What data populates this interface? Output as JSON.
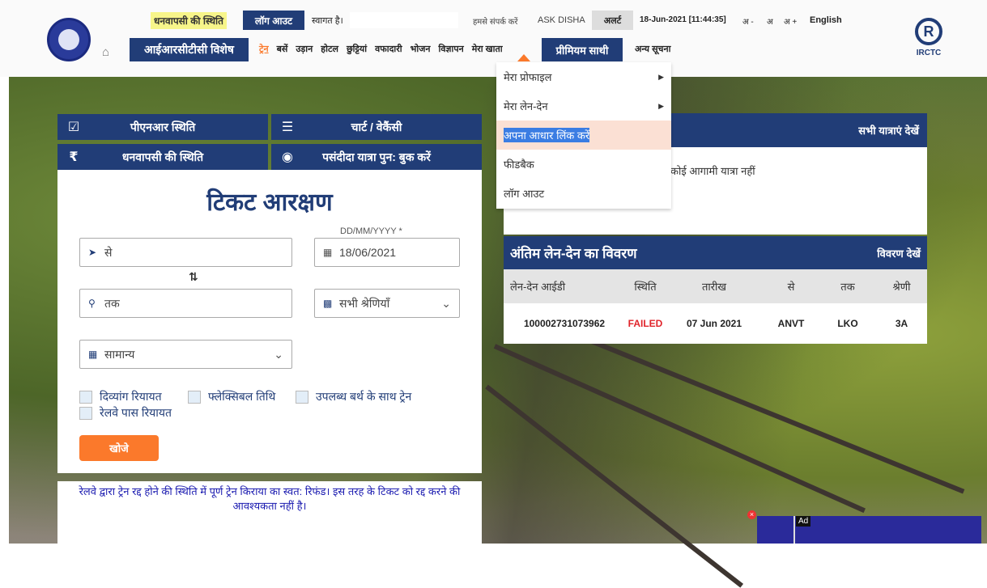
{
  "header": {
    "refund_status": "धनवापसी की स्थिति",
    "logout": "लॉग आउट",
    "welcome": "स्वागत है।",
    "contact": "हमसे संपर्क करें",
    "ask_disha": "ASK DISHA",
    "alert": "अलर्ट",
    "datetime": "18-Jun-2021 [11:44:35]",
    "font_small": "अ -",
    "font_normal": "अ",
    "font_large": "अ +",
    "language": "English",
    "irctc_special": "आईआरसीटीसी विशेष",
    "nav": [
      "ट्रेन",
      "बसें",
      "उड़ान",
      "होटल",
      "छुट्टियां",
      "वफादारी",
      "भोजन",
      "विज्ञापन",
      "मेरा खाता"
    ],
    "premium": "प्रीमियम साथी",
    "other_info": "अन्य सूचना",
    "irctc_logo_text": "IRCTC"
  },
  "dropdown": {
    "items": [
      "मेरा प्रोफाइल",
      "मेरा लेन-देन",
      "अपना आधार लिंक करें",
      "फीडबैक",
      "लॉग आउट"
    ]
  },
  "tiles": {
    "pnr": "पीएनआर स्थिति",
    "chart": "चार्ट / वेकैंसी",
    "refund": "धनवापसी की स्थिति",
    "favourite": "पसंदीदा यात्रा पुन: बुक करें"
  },
  "booking": {
    "title": "टिकट आरक्षण",
    "from_placeholder": "से",
    "date_label": "DD/MM/YYYY *",
    "date": "18/06/2021",
    "to_placeholder": "तक",
    "class": "सभी श्रेणियाँ",
    "quota": "सामान्य",
    "checkboxes": [
      "दिव्यांग रियायत",
      "फ्लेक्सिबल तिथि",
      "उपलब्ध बर्थ के साथ ट्रेन",
      "रेलवे पास रियायत"
    ],
    "search": "खोजे"
  },
  "notice": "रेलवे द्वारा ट्रेन रद्द होने की स्थिति में पूर्ण ट्रेन किराया का स्वत: रिफंड। इस तरह के टिकट को रद्द करने की आवश्यकता नहीं है।",
  "trips": {
    "view_all": "सभी यात्राएं देखें",
    "empty": "कोई आगामी यात्रा नहीं"
  },
  "transactions": {
    "title": "अंतिम लेन-देन का विवरण",
    "view_details": "विवरण देखें",
    "columns": [
      "लेन-देन आईडी",
      "स्थिति",
      "तारीख",
      "से",
      "तक",
      "श्रेणी"
    ],
    "rows": [
      [
        "100002731073962",
        "FAILED",
        "07 Jun 2021",
        "ANVT",
        "LKO",
        "3A"
      ]
    ]
  },
  "ad": {
    "label": "Ad"
  },
  "colors": {
    "primary": "#213d77",
    "accent": "#fb792b",
    "failed": "#e0242b",
    "highlight": "#f7f58a"
  }
}
